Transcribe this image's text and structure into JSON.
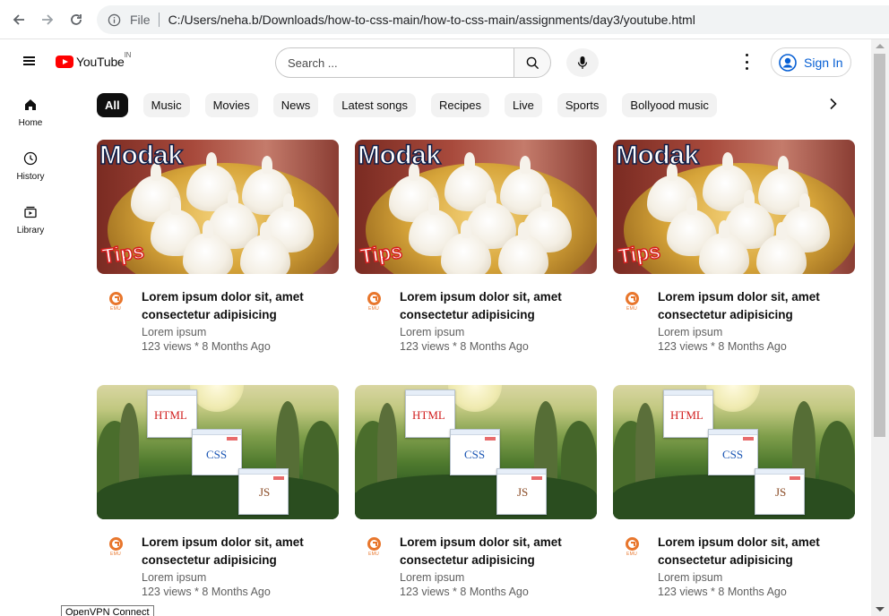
{
  "browser": {
    "scheme": "File",
    "url": "C:/Users/neha.b/Downloads/how-to-css-main/how-to-css-main/assignments/day3/youtube.html",
    "back_icon": "arrow-left-icon",
    "forward_icon": "arrow-right-icon",
    "reload_icon": "reload-icon",
    "info_icon": "info-icon"
  },
  "header": {
    "logo_text": "YouTube",
    "logo_region": "IN",
    "search_placeholder": "Search ...",
    "signin_label": "Sign In",
    "accent_color": "#ff0000",
    "signin_color": "#065fd4"
  },
  "sidebar": {
    "items": [
      {
        "label": "Home",
        "icon": "home-icon"
      },
      {
        "label": "History",
        "icon": "history-icon"
      },
      {
        "label": "Library",
        "icon": "library-icon"
      }
    ]
  },
  "chips": [
    "All",
    "Music",
    "Movies",
    "News",
    "Latest songs",
    "Recipes",
    "Live",
    "Sports",
    "Bollyood music"
  ],
  "videos": [
    {
      "thumb": "modak",
      "thumb_title": "Modak",
      "thumb_tag": "Tips",
      "title_line1": "Lorem ipsum dolor sit, amet",
      "title_line2": "consectetur adipisicing",
      "channel": "Lorem ipsum",
      "stats": "123 views * 8 Months Ago",
      "channel_brand": "EMU"
    },
    {
      "thumb": "modak",
      "thumb_title": "Modak",
      "thumb_tag": "Tips",
      "title_line1": "Lorem ipsum dolor sit, amet",
      "title_line2": "consectetur adipisicing",
      "channel": "Lorem ipsum",
      "stats": "123 views * 8 Months Ago",
      "channel_brand": "EMU"
    },
    {
      "thumb": "modak",
      "thumb_title": "Modak",
      "thumb_tag": "Tips",
      "title_line1": "Lorem ipsum dolor sit, amet",
      "title_line2": "consectetur adipisicing",
      "channel": "Lorem ipsum",
      "stats": "123 views * 8 Months Ago",
      "channel_brand": "EMU"
    },
    {
      "thumb": "landscape",
      "win_labels": [
        "HTML",
        "CSS",
        "JS"
      ],
      "title_line1": "Lorem ipsum dolor sit, amet",
      "title_line2": "consectetur adipisicing",
      "channel": "Lorem ipsum",
      "stats": "123 views * 8 Months Ago",
      "channel_brand": "EMU"
    },
    {
      "thumb": "landscape",
      "win_labels": [
        "HTML",
        "CSS",
        "JS"
      ],
      "title_line1": "Lorem ipsum dolor sit, amet",
      "title_line2": "consectetur adipisicing",
      "channel": "Lorem ipsum",
      "stats": "123 views * 8 Months Ago",
      "channel_brand": "EMU"
    },
    {
      "thumb": "landscape",
      "win_labels": [
        "HTML",
        "CSS",
        "JS"
      ],
      "title_line1": "Lorem ipsum dolor sit, amet",
      "title_line2": "consectetur adipisicing",
      "channel": "Lorem ipsum",
      "stats": "123 views * 8 Months Ago",
      "channel_brand": "EMU"
    }
  ],
  "tooltip": "OpenVPN Connect"
}
